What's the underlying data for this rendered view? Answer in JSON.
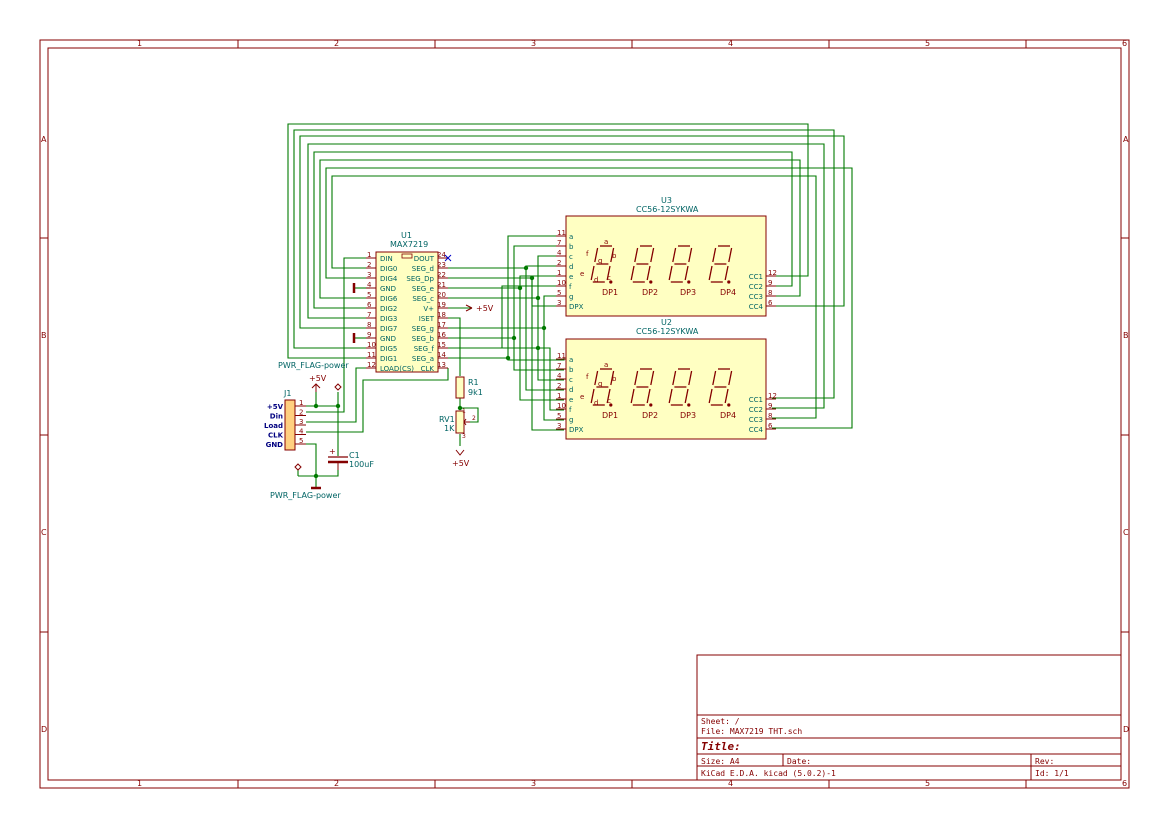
{
  "sheet": {
    "cols": [
      "1",
      "2",
      "3",
      "4",
      "5",
      "6"
    ],
    "rows": [
      "A",
      "B",
      "C",
      "D"
    ]
  },
  "title_block": {
    "sheet": "Sheet: /",
    "file": "File: MAX7219 THT.sch",
    "title": "Title:",
    "size": "Size: A4",
    "date": "Date:",
    "rev": "Rev:",
    "tool": "KiCad E.D.A.  kicad (5.0.2)-1",
    "id": "Id: 1/1"
  },
  "u1": {
    "ref": "U1",
    "value": "MAX7219",
    "left_pins": [
      {
        "num": "1",
        "name": "DIN"
      },
      {
        "num": "2",
        "name": "DIG0"
      },
      {
        "num": "3",
        "name": "DIG4"
      },
      {
        "num": "4",
        "name": "GND"
      },
      {
        "num": "5",
        "name": "DIG6"
      },
      {
        "num": "6",
        "name": "DIG2"
      },
      {
        "num": "7",
        "name": "DIG3"
      },
      {
        "num": "8",
        "name": "DIG7"
      },
      {
        "num": "9",
        "name": "GND"
      },
      {
        "num": "10",
        "name": "DIG5"
      },
      {
        "num": "11",
        "name": "DIG1"
      },
      {
        "num": "12",
        "name": "LOAD(CS)"
      }
    ],
    "right_pins": [
      {
        "num": "24",
        "name": "DOUT"
      },
      {
        "num": "23",
        "name": "SEG_d"
      },
      {
        "num": "22",
        "name": "SEG_Dp"
      },
      {
        "num": "21",
        "name": "SEG_e"
      },
      {
        "num": "20",
        "name": "SEG_c"
      },
      {
        "num": "19",
        "name": "V+"
      },
      {
        "num": "18",
        "name": "ISET"
      },
      {
        "num": "17",
        "name": "SEG_g"
      },
      {
        "num": "16",
        "name": "SEG_b"
      },
      {
        "num": "15",
        "name": "SEG_f"
      },
      {
        "num": "14",
        "name": "SEG_a"
      },
      {
        "num": "13",
        "name": "CLK"
      }
    ]
  },
  "u3": {
    "ref": "U3",
    "value": "CC56-12SYKWA"
  },
  "u2": {
    "ref": "U2",
    "value": "CC56-12SYKWA"
  },
  "display": {
    "left_pins": [
      {
        "num": "11",
        "name": "a"
      },
      {
        "num": "7",
        "name": "b"
      },
      {
        "num": "4",
        "name": "c"
      },
      {
        "num": "2",
        "name": "d"
      },
      {
        "num": "1",
        "name": "e"
      },
      {
        "num": "10",
        "name": "f"
      },
      {
        "num": "5",
        "name": "g"
      },
      {
        "num": "3",
        "name": "DPX"
      }
    ],
    "right_pins": [
      {
        "num": "12",
        "name": "CC1"
      },
      {
        "num": "9",
        "name": "CC2"
      },
      {
        "num": "8",
        "name": "CC3"
      },
      {
        "num": "6",
        "name": "CC4"
      }
    ],
    "dp_labels": [
      "DP1",
      "DP2",
      "DP3",
      "DP4"
    ],
    "seg_letters": {
      "a": "a",
      "b": "b",
      "c": "c",
      "d": "d",
      "e": "e",
      "f": "f",
      "g": "g"
    }
  },
  "j1": {
    "ref": "J1",
    "pins": [
      {
        "num": "1",
        "label": "+5V"
      },
      {
        "num": "2",
        "label": "Din"
      },
      {
        "num": "3",
        "label": "Load"
      },
      {
        "num": "4",
        "label": "CLK"
      },
      {
        "num": "5",
        "label": "GND"
      }
    ]
  },
  "power": {
    "plus5v": "+5V",
    "pwr_flag": "PWR_FLAG-power"
  },
  "r1": {
    "ref": "R1",
    "value": "9k1"
  },
  "rv1": {
    "ref": "RV1",
    "value": "1K",
    "pin1": "1",
    "pin2": "2",
    "pin3": "3"
  },
  "c1": {
    "ref": "C1",
    "value": "100uF",
    "plus": "+"
  }
}
